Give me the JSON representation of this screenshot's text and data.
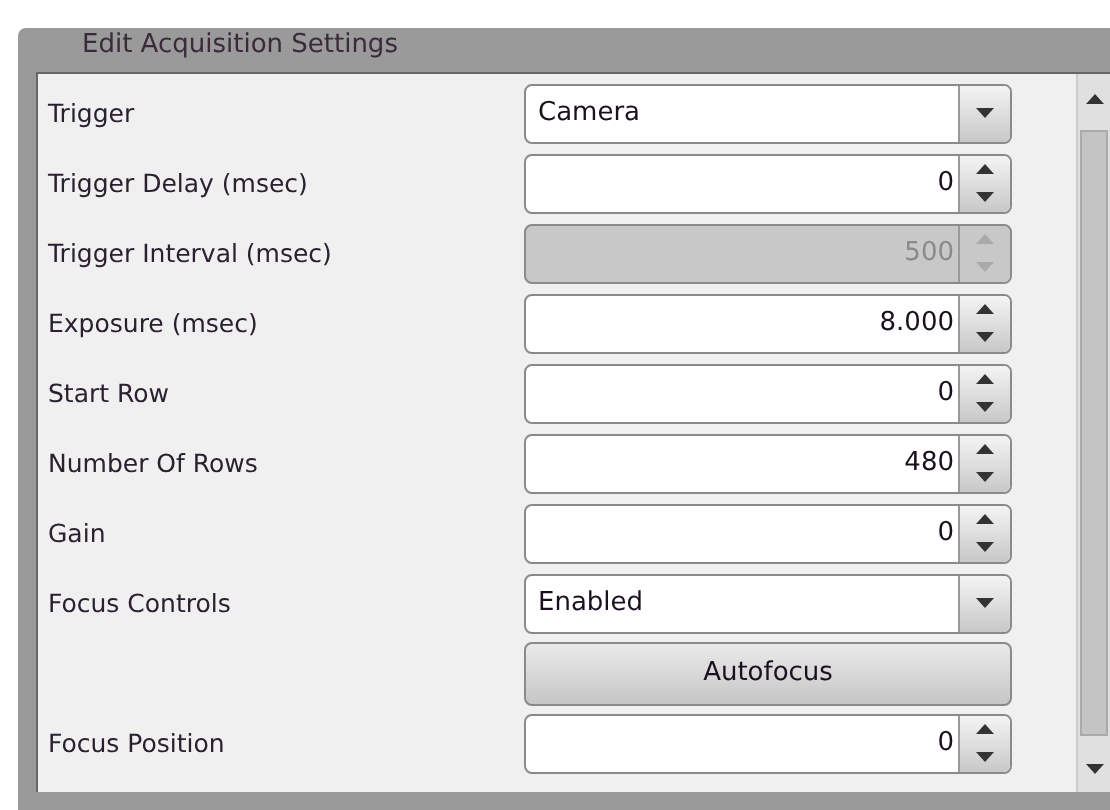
{
  "group": {
    "title": "Edit Acquisition Settings"
  },
  "rows": [
    {
      "kind": "combo",
      "label": "Trigger",
      "value": "Camera",
      "disabled": false
    },
    {
      "kind": "spin",
      "label": "Trigger Delay (msec)",
      "value": "0",
      "disabled": false
    },
    {
      "kind": "spin",
      "label": "Trigger Interval (msec)",
      "value": "500",
      "disabled": true
    },
    {
      "kind": "spin",
      "label": "Exposure (msec)",
      "value": "8.000",
      "disabled": false
    },
    {
      "kind": "spin",
      "label": "Start Row",
      "value": "0",
      "disabled": false
    },
    {
      "kind": "spin",
      "label": "Number Of Rows",
      "value": "480",
      "disabled": false
    },
    {
      "kind": "spin",
      "label": "Gain",
      "value": "0",
      "disabled": false
    },
    {
      "kind": "combo",
      "label": "Focus Controls",
      "value": "Enabled",
      "disabled": false
    },
    {
      "kind": "button",
      "value": "Autofocus",
      "disabled": false
    },
    {
      "kind": "spin",
      "label": "Focus Position",
      "value": "0",
      "disabled": false
    }
  ]
}
